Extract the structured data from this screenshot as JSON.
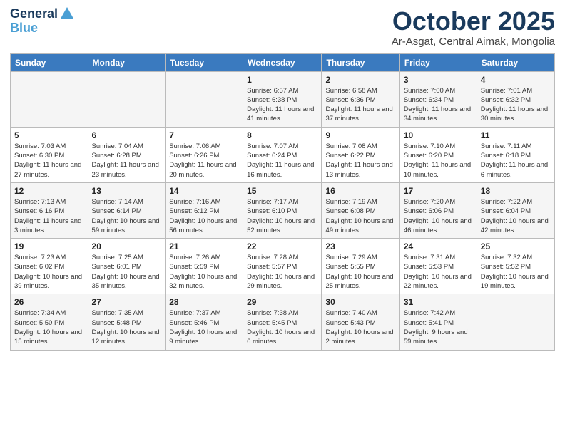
{
  "header": {
    "logo_line1": "General",
    "logo_line2": "Blue",
    "month": "October 2025",
    "location": "Ar-Asgat, Central Aimak, Mongolia"
  },
  "weekdays": [
    "Sunday",
    "Monday",
    "Tuesday",
    "Wednesday",
    "Thursday",
    "Friday",
    "Saturday"
  ],
  "weeks": [
    [
      {
        "day": "",
        "sunrise": "",
        "sunset": "",
        "daylight": ""
      },
      {
        "day": "",
        "sunrise": "",
        "sunset": "",
        "daylight": ""
      },
      {
        "day": "",
        "sunrise": "",
        "sunset": "",
        "daylight": ""
      },
      {
        "day": "1",
        "sunrise": "Sunrise: 6:57 AM",
        "sunset": "Sunset: 6:38 PM",
        "daylight": "Daylight: 11 hours and 41 minutes."
      },
      {
        "day": "2",
        "sunrise": "Sunrise: 6:58 AM",
        "sunset": "Sunset: 6:36 PM",
        "daylight": "Daylight: 11 hours and 37 minutes."
      },
      {
        "day": "3",
        "sunrise": "Sunrise: 7:00 AM",
        "sunset": "Sunset: 6:34 PM",
        "daylight": "Daylight: 11 hours and 34 minutes."
      },
      {
        "day": "4",
        "sunrise": "Sunrise: 7:01 AM",
        "sunset": "Sunset: 6:32 PM",
        "daylight": "Daylight: 11 hours and 30 minutes."
      }
    ],
    [
      {
        "day": "5",
        "sunrise": "Sunrise: 7:03 AM",
        "sunset": "Sunset: 6:30 PM",
        "daylight": "Daylight: 11 hours and 27 minutes."
      },
      {
        "day": "6",
        "sunrise": "Sunrise: 7:04 AM",
        "sunset": "Sunset: 6:28 PM",
        "daylight": "Daylight: 11 hours and 23 minutes."
      },
      {
        "day": "7",
        "sunrise": "Sunrise: 7:06 AM",
        "sunset": "Sunset: 6:26 PM",
        "daylight": "Daylight: 11 hours and 20 minutes."
      },
      {
        "day": "8",
        "sunrise": "Sunrise: 7:07 AM",
        "sunset": "Sunset: 6:24 PM",
        "daylight": "Daylight: 11 hours and 16 minutes."
      },
      {
        "day": "9",
        "sunrise": "Sunrise: 7:08 AM",
        "sunset": "Sunset: 6:22 PM",
        "daylight": "Daylight: 11 hours and 13 minutes."
      },
      {
        "day": "10",
        "sunrise": "Sunrise: 7:10 AM",
        "sunset": "Sunset: 6:20 PM",
        "daylight": "Daylight: 11 hours and 10 minutes."
      },
      {
        "day": "11",
        "sunrise": "Sunrise: 7:11 AM",
        "sunset": "Sunset: 6:18 PM",
        "daylight": "Daylight: 11 hours and 6 minutes."
      }
    ],
    [
      {
        "day": "12",
        "sunrise": "Sunrise: 7:13 AM",
        "sunset": "Sunset: 6:16 PM",
        "daylight": "Daylight: 11 hours and 3 minutes."
      },
      {
        "day": "13",
        "sunrise": "Sunrise: 7:14 AM",
        "sunset": "Sunset: 6:14 PM",
        "daylight": "Daylight: 10 hours and 59 minutes."
      },
      {
        "day": "14",
        "sunrise": "Sunrise: 7:16 AM",
        "sunset": "Sunset: 6:12 PM",
        "daylight": "Daylight: 10 hours and 56 minutes."
      },
      {
        "day": "15",
        "sunrise": "Sunrise: 7:17 AM",
        "sunset": "Sunset: 6:10 PM",
        "daylight": "Daylight: 10 hours and 52 minutes."
      },
      {
        "day": "16",
        "sunrise": "Sunrise: 7:19 AM",
        "sunset": "Sunset: 6:08 PM",
        "daylight": "Daylight: 10 hours and 49 minutes."
      },
      {
        "day": "17",
        "sunrise": "Sunrise: 7:20 AM",
        "sunset": "Sunset: 6:06 PM",
        "daylight": "Daylight: 10 hours and 46 minutes."
      },
      {
        "day": "18",
        "sunrise": "Sunrise: 7:22 AM",
        "sunset": "Sunset: 6:04 PM",
        "daylight": "Daylight: 10 hours and 42 minutes."
      }
    ],
    [
      {
        "day": "19",
        "sunrise": "Sunrise: 7:23 AM",
        "sunset": "Sunset: 6:02 PM",
        "daylight": "Daylight: 10 hours and 39 minutes."
      },
      {
        "day": "20",
        "sunrise": "Sunrise: 7:25 AM",
        "sunset": "Sunset: 6:01 PM",
        "daylight": "Daylight: 10 hours and 35 minutes."
      },
      {
        "day": "21",
        "sunrise": "Sunrise: 7:26 AM",
        "sunset": "Sunset: 5:59 PM",
        "daylight": "Daylight: 10 hours and 32 minutes."
      },
      {
        "day": "22",
        "sunrise": "Sunrise: 7:28 AM",
        "sunset": "Sunset: 5:57 PM",
        "daylight": "Daylight: 10 hours and 29 minutes."
      },
      {
        "day": "23",
        "sunrise": "Sunrise: 7:29 AM",
        "sunset": "Sunset: 5:55 PM",
        "daylight": "Daylight: 10 hours and 25 minutes."
      },
      {
        "day": "24",
        "sunrise": "Sunrise: 7:31 AM",
        "sunset": "Sunset: 5:53 PM",
        "daylight": "Daylight: 10 hours and 22 minutes."
      },
      {
        "day": "25",
        "sunrise": "Sunrise: 7:32 AM",
        "sunset": "Sunset: 5:52 PM",
        "daylight": "Daylight: 10 hours and 19 minutes."
      }
    ],
    [
      {
        "day": "26",
        "sunrise": "Sunrise: 7:34 AM",
        "sunset": "Sunset: 5:50 PM",
        "daylight": "Daylight: 10 hours and 15 minutes."
      },
      {
        "day": "27",
        "sunrise": "Sunrise: 7:35 AM",
        "sunset": "Sunset: 5:48 PM",
        "daylight": "Daylight: 10 hours and 12 minutes."
      },
      {
        "day": "28",
        "sunrise": "Sunrise: 7:37 AM",
        "sunset": "Sunset: 5:46 PM",
        "daylight": "Daylight: 10 hours and 9 minutes."
      },
      {
        "day": "29",
        "sunrise": "Sunrise: 7:38 AM",
        "sunset": "Sunset: 5:45 PM",
        "daylight": "Daylight: 10 hours and 6 minutes."
      },
      {
        "day": "30",
        "sunrise": "Sunrise: 7:40 AM",
        "sunset": "Sunset: 5:43 PM",
        "daylight": "Daylight: 10 hours and 2 minutes."
      },
      {
        "day": "31",
        "sunrise": "Sunrise: 7:42 AM",
        "sunset": "Sunset: 5:41 PM",
        "daylight": "Daylight: 9 hours and 59 minutes."
      },
      {
        "day": "",
        "sunrise": "",
        "sunset": "",
        "daylight": ""
      }
    ]
  ]
}
